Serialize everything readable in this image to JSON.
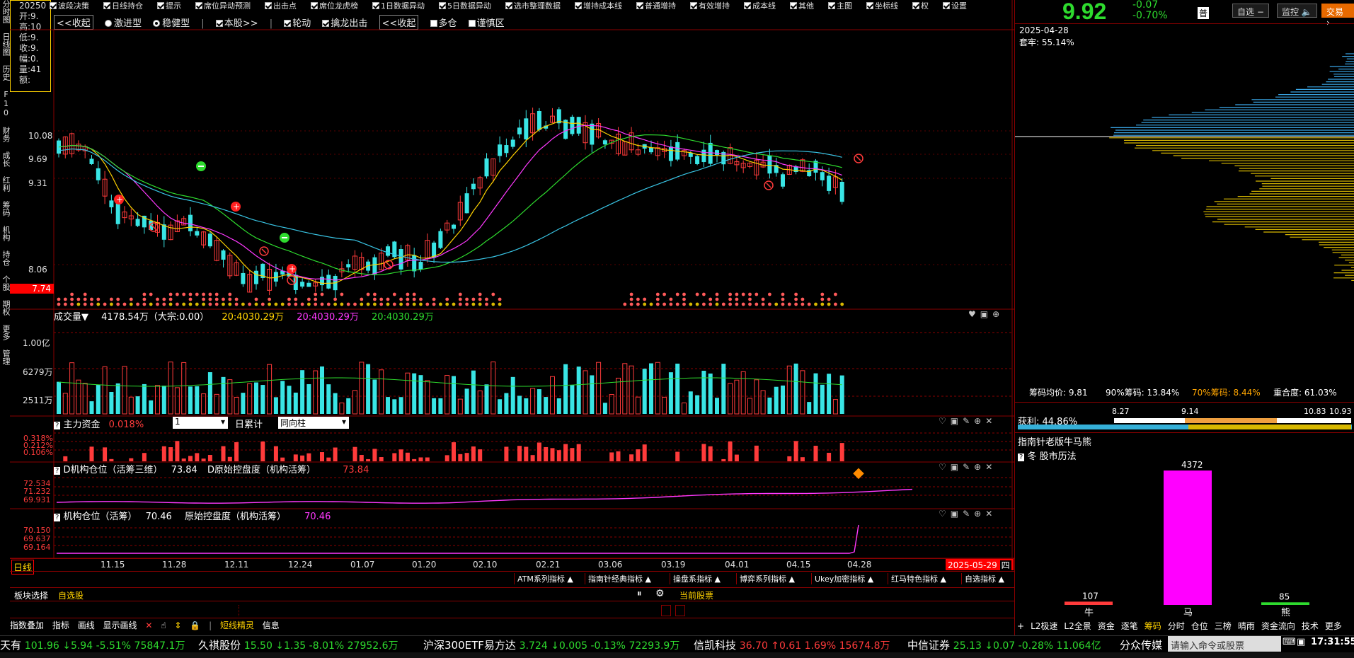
{
  "stock": {
    "price": "9.92",
    "change": "-0.07",
    "change_pct": "-0.70%",
    "badge": "普"
  },
  "right_buttons": {
    "watchlist": "自选",
    "monitor": "监控",
    "trade": "交易"
  },
  "info_panel": {
    "date": "20250",
    "open": "开:9.",
    "high": "高:10",
    "low": "低:9.",
    "close": "收:9.",
    "amplitude": "幅:0.",
    "volume": "量:41",
    "more": "额:"
  },
  "top_toolbar": {
    "items": [
      "波段决策",
      "日线持仓",
      "提示",
      "席位异动预测",
      "出击点",
      "席位龙虎榜",
      "1日数据异动",
      "5日数据异动",
      "选市整理数据",
      "增持成本线",
      "普通增持",
      "有效增持",
      "成本线",
      "其他",
      "主图",
      "坐标线",
      "权",
      "设置"
    ]
  },
  "toolbar2": {
    "collapse1": "<<收起",
    "radio1": "激进型",
    "radio2": "稳健型",
    "chk_stock": "本股>>",
    "chk_rotation": "轮动",
    "chk_dragon": "擒龙出击",
    "collapse2": "<<收起",
    "chk_long": "多仓",
    "chk_careful": "谨慎区"
  },
  "left_nav": "分时图 日线图 历史 F10 财务 成长 红利 筹码 机构 持仓 个股 期权 更多 管理",
  "price_axis": [
    "10.08",
    "9.69",
    "9.31",
    "8.06"
  ],
  "price_marker": "7.74",
  "volume_panel": {
    "title": "成交量▼",
    "value": "4178.54万（大宗:0.00）",
    "ma1": "20:4030.29万",
    "ma2": "20:4030.29万",
    "ma3": "20:4030.29万",
    "axis": [
      "1.00亿",
      "6279万",
      "2511万"
    ]
  },
  "capital_panel": {
    "title": "主力资金",
    "value": "0.018%",
    "select1": "1",
    "label": "日累计",
    "select2": "同向柱",
    "axis": [
      "0.318%",
      "0.212%",
      "0.106%"
    ]
  },
  "d_panel": {
    "title": "D机构仓位（活筹三维）",
    "value": "73.84",
    "title2": "D原始控盘度（机构活筹）",
    "value2": "73.84",
    "axis": [
      "72.534",
      "71.232",
      "69.931"
    ]
  },
  "inst_panel": {
    "title": "机构仓位（活筹）",
    "value": "70.46",
    "title2": "原始控盘度（机构活筹）",
    "value2": "70.46",
    "axis": [
      "70.150",
      "69.637",
      "69.164"
    ]
  },
  "x_axis": {
    "period": "日线",
    "dates": [
      "11.15",
      "11.28",
      "12.11",
      "12.24",
      "01.07",
      "01.20",
      "02.10",
      "02.21",
      "03.06",
      "03.19",
      "04.01",
      "04.15",
      "04.28"
    ],
    "current_date": "2025-05-29",
    "weekday": "四"
  },
  "indicator_tabs": [
    "ATM系列指标",
    "指南针经典指标",
    "操盘系指标",
    "博弈系列指标",
    "Ukey加密指标",
    "红马特色指标",
    "自选指标"
  ],
  "sector": {
    "label": "板块选择",
    "value": "自选股",
    "current": "当前股票"
  },
  "function_bar": [
    "指数叠加",
    "指标",
    "画线",
    "显示画线",
    "短线精灵",
    "信息"
  ],
  "right_tabs": [
    "L2极速",
    "L2全景",
    "资金",
    "逐笔",
    "筹码",
    "分时",
    "仓位",
    "三榜",
    "晴雨",
    "资金流向",
    "技术",
    "更多"
  ],
  "chip": {
    "date": "2025-04-28",
    "trapped": "套牢: 55.14%",
    "avg": "筹码均价: 9.81",
    "pct90": "90%筹码: 13.84%",
    "pct70": "70%筹码: 8.44%",
    "overlap": "重合度: 61.03%",
    "profit": "获利: 44.86%",
    "scale": [
      "8.27",
      "9.14",
      "10.83",
      "10.93"
    ]
  },
  "bullbear": {
    "title": "指南针老版牛马熊",
    "subtitle": "冬  股市历法",
    "bars": [
      {
        "label": "牛",
        "value": 107,
        "color": "#ff3b3b"
      },
      {
        "label": "马",
        "value": 4372,
        "color": "#ff00ff"
      },
      {
        "label": "熊",
        "value": 85,
        "color": "#2edb2e"
      }
    ]
  },
  "status_bar": {
    "items": [
      {
        "name": "天有",
        "price": "101.96",
        "arrow": "↓",
        "chg": "5.94",
        "pct": "-5.51%",
        "amt": "75847.1万",
        "dir": "down"
      },
      {
        "name": "久祺股份",
        "price": "15.50",
        "arrow": "↓",
        "chg": "1.35",
        "pct": "-8.01%",
        "amt": "27952.6万",
        "dir": "down"
      },
      {
        "name": "沪深300ETF易方达",
        "price": "3.724",
        "arrow": "↓",
        "chg": "0.005",
        "pct": "-0.13%",
        "amt": "72293.9万",
        "dir": "down"
      },
      {
        "name": "信凯科技",
        "price": "36.70",
        "arrow": "↑",
        "chg": "0.61",
        "pct": "1.69%",
        "amt": "15674.8万",
        "dir": "up"
      },
      {
        "name": "中信证券",
        "price": "25.13",
        "arrow": "↓",
        "chg": "0.07",
        "pct": "-0.28%",
        "amt": "11.064亿",
        "dir": "down"
      },
      {
        "name": "分众传媒",
        "price": "",
        "arrow": "",
        "chg": "",
        "pct": "",
        "amt": "",
        "dir": "down"
      }
    ],
    "command_placeholder": "请输入命令或股票",
    "time": "17:31:55"
  }
}
